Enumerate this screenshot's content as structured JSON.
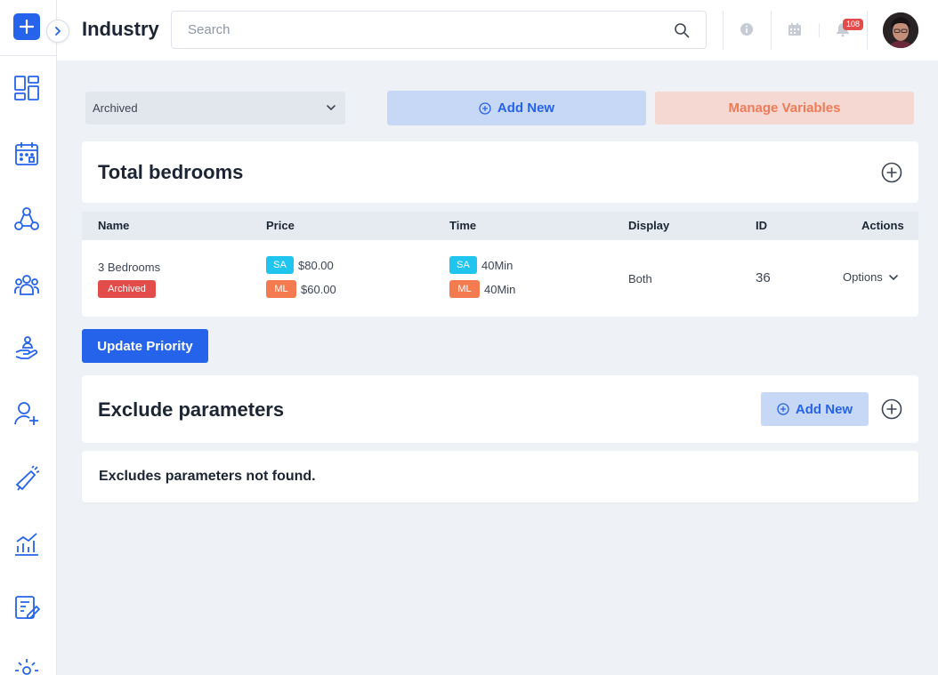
{
  "header": {
    "title": "Industry",
    "search_placeholder": "Search",
    "notification_count": "108"
  },
  "filter": {
    "selected": "Archived"
  },
  "actions": {
    "add_new_label": "Add New",
    "manage_variables_label": "Manage Variables"
  },
  "total_bedrooms": {
    "title": "Total bedrooms",
    "columns": [
      "Name",
      "Price",
      "Time",
      "Display",
      "ID",
      "Actions"
    ],
    "row": {
      "name": "3 Bedrooms",
      "status": "Archived",
      "prices": [
        {
          "tag": "SA",
          "value": "$80.00"
        },
        {
          "tag": "ML",
          "value": "$60.00"
        }
      ],
      "times": [
        {
          "tag": "SA",
          "value": "40Min"
        },
        {
          "tag": "ML",
          "value": "40Min"
        }
      ],
      "display": "Both",
      "id": "36",
      "actions_label": "Options"
    }
  },
  "update_priority_label": "Update Priority",
  "exclude_parameters": {
    "title": "Exclude parameters",
    "add_new_label": "Add New",
    "empty_message": "Excludes parameters not found."
  },
  "colors": {
    "primary": "#2563eb",
    "accent": "#ee7b58",
    "sa_tag": "#1fc5ee",
    "ml_tag": "#f47a4f",
    "archived_tag": "#e24c4b"
  },
  "sidebar": {
    "icons": [
      "dashboard-icon",
      "calendar-icon",
      "network-icon",
      "team-icon",
      "service-hand-icon",
      "add-user-icon",
      "megaphone-icon",
      "analytics-icon",
      "edit-document-icon",
      "settings-icon"
    ]
  }
}
